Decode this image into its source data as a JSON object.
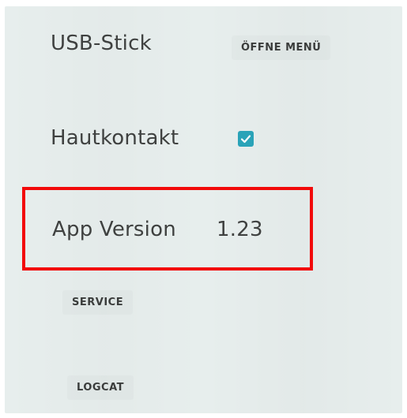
{
  "settings": {
    "usb_stick": {
      "label": "USB-Stick",
      "button_label": "ÖFFNE MENÜ"
    },
    "skin_contact": {
      "label": "Hautkontakt",
      "checked": true
    },
    "app_version": {
      "label": "App Version",
      "value": "1.23"
    },
    "service_button_label": "SERVICE",
    "logcat_button_label": "LOGCAT"
  },
  "colors": {
    "accent": "#2aa3b8",
    "highlight": "#f20a0a",
    "background": "#e7eeed",
    "text": "#3f4140"
  },
  "icons": {
    "checkbox": "checkmark-icon"
  }
}
